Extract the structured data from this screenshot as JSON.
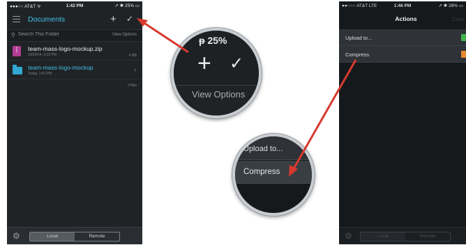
{
  "left_screen": {
    "status": {
      "carrier": "●●●○○ AT&T ᯤ",
      "time": "1:42 PM",
      "battery": "➚ ✱ 25% ▭"
    },
    "nav_title": "Documents",
    "search": {
      "placeholder": "Search This Folder",
      "view_options": "View Options"
    },
    "files": [
      {
        "name": "team-mass-logo-mockup.zip",
        "meta": "10/29/14, 3:22 PM",
        "size": "4 MB",
        "icon": "zip-file-icon"
      },
      {
        "name": "team-mass-logo-mockup",
        "meta": "Today, 1:41 PM",
        "icon": "folder-icon"
      }
    ],
    "item_count": "2 files",
    "segments": {
      "local": "Local",
      "remote": "Remote",
      "selected": "Local"
    }
  },
  "zoom_top": {
    "battery": "ᵽ 25%",
    "view_options": "View Options"
  },
  "zoom_bottom": {
    "upload": "Upload to...",
    "compress": "Compress"
  },
  "right_screen": {
    "status": {
      "carrier": "●●○○○ AT&T LTE",
      "time": "1:46 PM",
      "battery": "➚ ✱ 28% ▭"
    },
    "title": "Actions",
    "cancel": "Canc",
    "actions": [
      {
        "label": "Upload to...",
        "icon_color": "#3fb24a"
      },
      {
        "label": "Compress",
        "icon_color": "#e5892f"
      }
    ],
    "segments": {
      "local": "Local",
      "remote": "Remote",
      "selected": "Local"
    }
  },
  "colors": {
    "accent": "#3ec0e6",
    "arrow": "#d63a2e"
  }
}
